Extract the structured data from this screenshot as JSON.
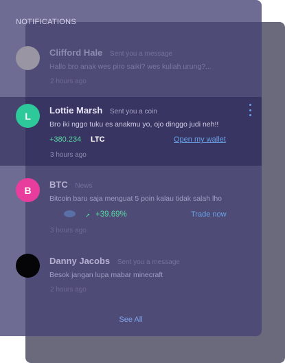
{
  "panel": {
    "title": "NOTIFICATIONS",
    "see_all_label": "See All"
  },
  "notifications": [
    {
      "name": "Clifford Hale",
      "action": "Sent you a message",
      "message": "Hallo bro anak wes piro saiki? wes kuliah urung?...",
      "time": "2 hours ago",
      "avatar_color": "#9a95a2"
    },
    {
      "name": "Lottie Marsh",
      "action": "Sent you a coin",
      "message": "Bro iki nggo tuku es anakmu yo, ojo dinggo judi neh!!",
      "amount": "+380.234",
      "ticker": "LTC",
      "link_label": "Open my wallet",
      "time": "3 hours ago",
      "avatar_letter": "L",
      "avatar_color": "#2ec99a"
    },
    {
      "name": "BTC",
      "action": "News",
      "message": "Bitcoin baru saja menguat 5 poin kalau tidak salah lho",
      "change": "+39.69%",
      "link_label": "Trade now",
      "time": "3 hours ago",
      "avatar_letter": "B",
      "avatar_color": "#e93d9e"
    },
    {
      "name": "Danny Jacobs",
      "action": "Sent you a message",
      "message": "Besok jangan lupa mabar minecraft",
      "time": "2 hours ago",
      "avatar_color": "#050508"
    }
  ],
  "icons": {
    "more": "kebab-menu-icon",
    "coin": "coin-icon",
    "trend": "trend-up-icon"
  },
  "colors": {
    "accent_green": "#58d8a0",
    "link_blue": "#6aa0e6",
    "panel_bg": "#464376"
  }
}
